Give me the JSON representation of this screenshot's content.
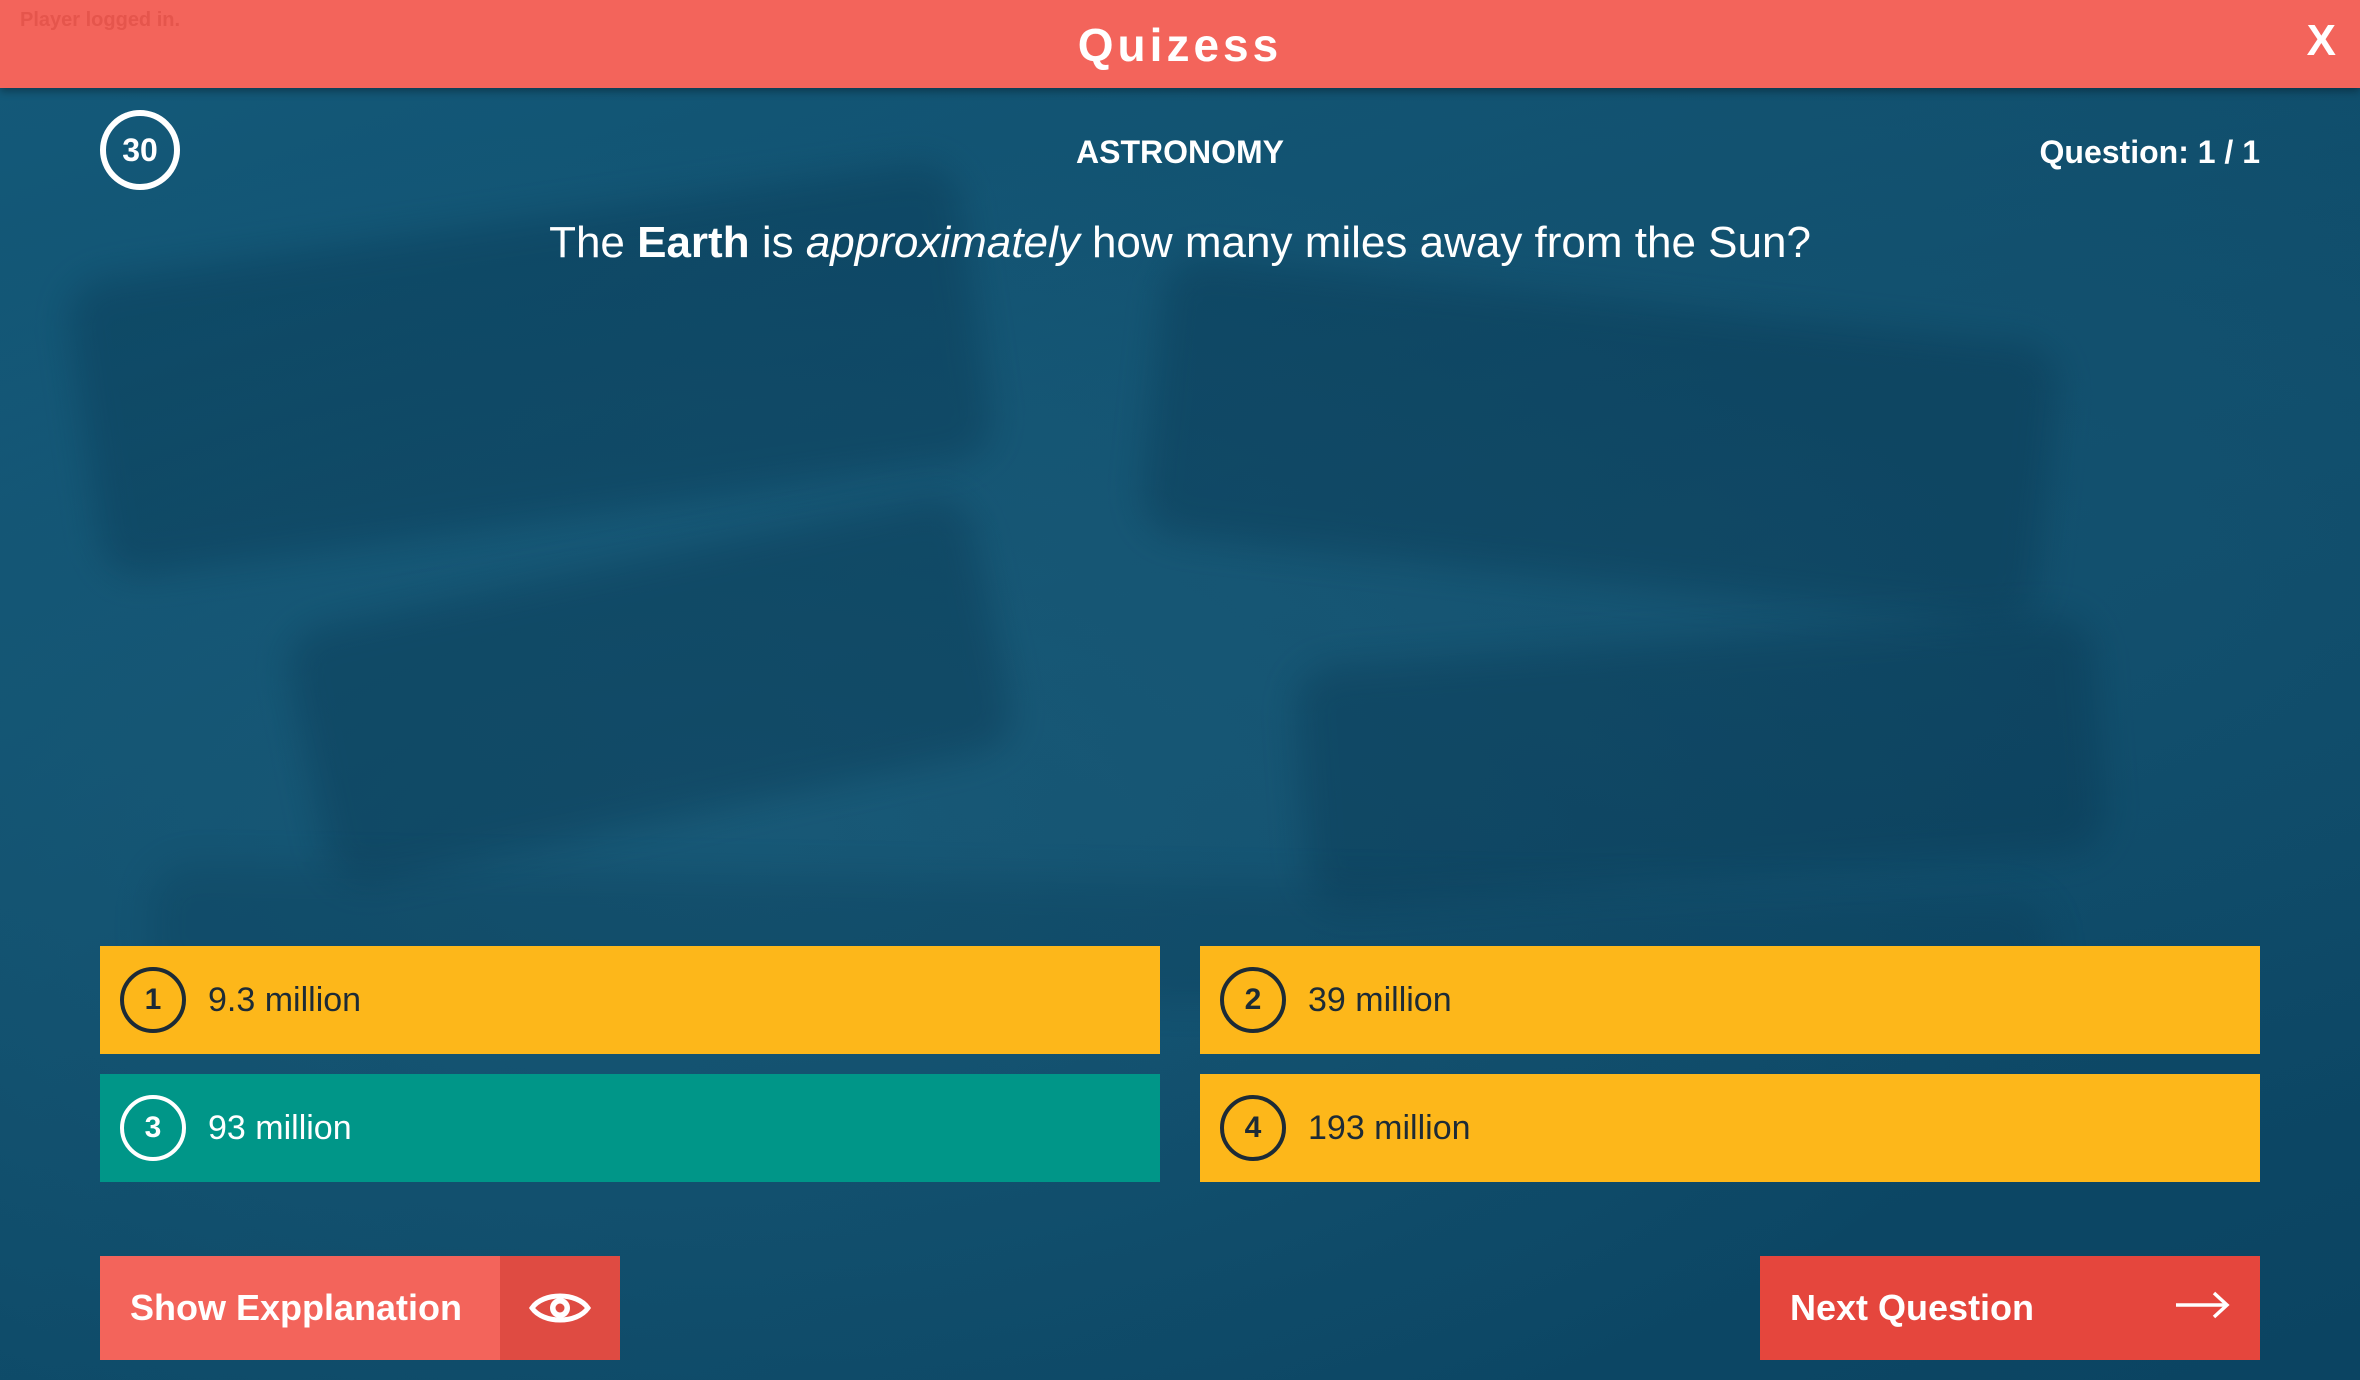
{
  "header": {
    "status": "Player logged in.",
    "title": "Quizess",
    "close_label": "X"
  },
  "quiz": {
    "timer": "30",
    "category": "ASTRONOMY",
    "counter": "Question: 1 / 1",
    "question": {
      "pre": "The ",
      "bold": "Earth",
      "mid": " is ",
      "italic": "approximately",
      "post": " how many miles away from the Sun?"
    }
  },
  "answers": [
    {
      "number": "1",
      "label": "9.3 million",
      "state": "default"
    },
    {
      "number": "2",
      "label": "39 million",
      "state": "default"
    },
    {
      "number": "3",
      "label": "93 million",
      "state": "correct"
    },
    {
      "number": "4",
      "label": "193 million",
      "state": "default"
    }
  ],
  "actions": {
    "explain_label": "Show Expplanation",
    "explain_icon": "eye-icon",
    "next_label": "Next Question",
    "next_icon": "arrow-right-icon"
  },
  "colors": {
    "header": "#f3645b",
    "background": "#0f4d6b",
    "answer_default": "#fdb71a",
    "answer_correct": "#009688",
    "button_primary": "#e5463d"
  }
}
